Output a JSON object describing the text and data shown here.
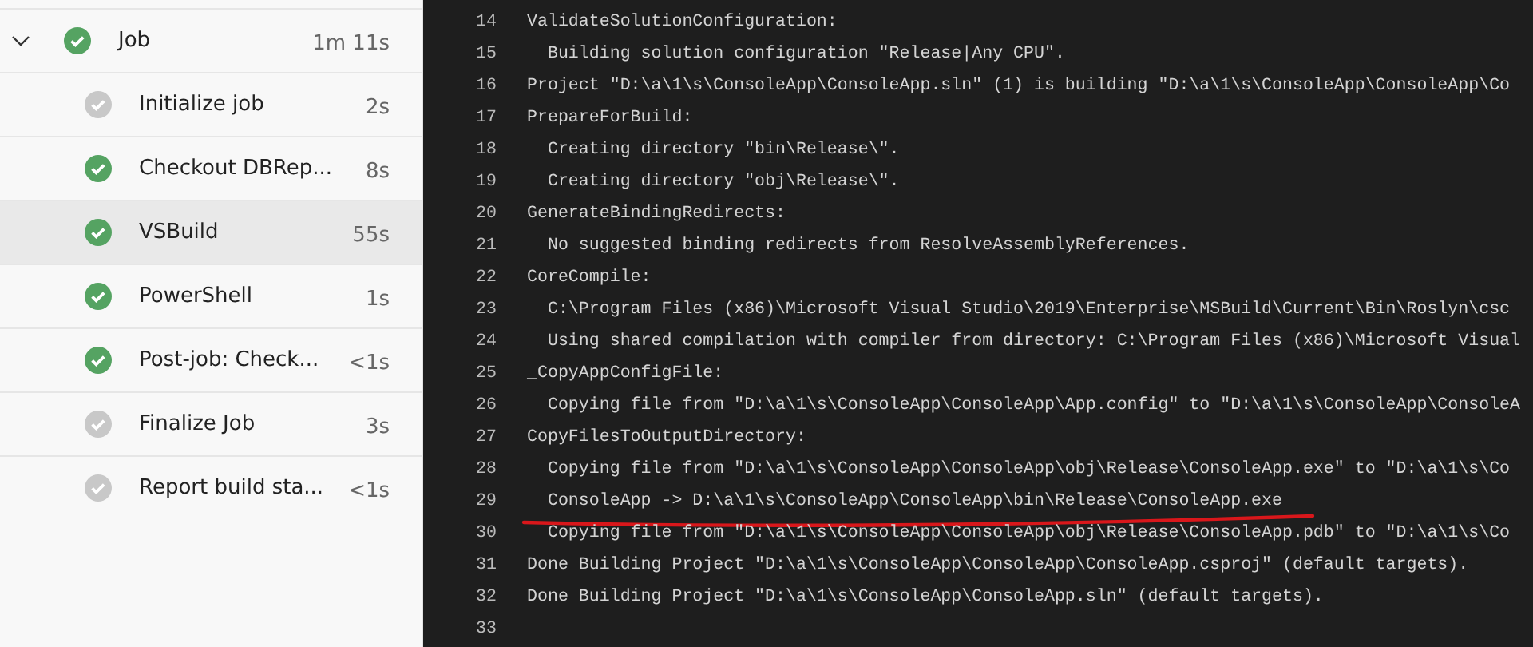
{
  "job": {
    "label": "Job",
    "duration": "1m 11s",
    "expanded": true,
    "color": "#55a362"
  },
  "steps": [
    {
      "label": "Initialize job",
      "duration": "2s",
      "color": "#c8c8c8",
      "selected": false
    },
    {
      "label": "Checkout DBRep...",
      "duration": "8s",
      "color": "#55a362",
      "selected": false
    },
    {
      "label": "VSBuild",
      "duration": "55s",
      "color": "#55a362",
      "selected": true
    },
    {
      "label": "PowerShell",
      "duration": "1s",
      "color": "#55a362",
      "selected": false
    },
    {
      "label": "Post-job: Check...",
      "duration": "<1s",
      "color": "#55a362",
      "selected": false
    },
    {
      "label": "Finalize Job",
      "duration": "3s",
      "color": "#c8c8c8",
      "selected": false
    },
    {
      "label": "Report build sta...",
      "duration": "<1s",
      "color": "#c8c8c8",
      "selected": false
    }
  ],
  "log": [
    {
      "number": "14",
      "text": "ValidateSolutionConfiguration:"
    },
    {
      "number": "15",
      "text": "  Building solution configuration \"Release|Any CPU\"."
    },
    {
      "number": "16",
      "text": "Project \"D:\\a\\1\\s\\ConsoleApp\\ConsoleApp.sln\" (1) is building \"D:\\a\\1\\s\\ConsoleApp\\ConsoleApp\\Co"
    },
    {
      "number": "17",
      "text": "PrepareForBuild:"
    },
    {
      "number": "18",
      "text": "  Creating directory \"bin\\Release\\\"."
    },
    {
      "number": "19",
      "text": "  Creating directory \"obj\\Release\\\"."
    },
    {
      "number": "20",
      "text": "GenerateBindingRedirects:"
    },
    {
      "number": "21",
      "text": "  No suggested binding redirects from ResolveAssemblyReferences."
    },
    {
      "number": "22",
      "text": "CoreCompile:"
    },
    {
      "number": "23",
      "text": "  C:\\Program Files (x86)\\Microsoft Visual Studio\\2019\\Enterprise\\MSBuild\\Current\\Bin\\Roslyn\\csc"
    },
    {
      "number": "24",
      "text": "  Using shared compilation with compiler from directory: C:\\Program Files (x86)\\Microsoft Visual"
    },
    {
      "number": "25",
      "text": "_CopyAppConfigFile:"
    },
    {
      "number": "26",
      "text": "  Copying file from \"D:\\a\\1\\s\\ConsoleApp\\ConsoleApp\\App.config\" to \"D:\\a\\1\\s\\ConsoleApp\\ConsoleA"
    },
    {
      "number": "27",
      "text": "CopyFilesToOutputDirectory:"
    },
    {
      "number": "28",
      "text": "  Copying file from \"D:\\a\\1\\s\\ConsoleApp\\ConsoleApp\\obj\\Release\\ConsoleApp.exe\" to \"D:\\a\\1\\s\\Co"
    },
    {
      "number": "29",
      "text": "  ConsoleApp -> D:\\a\\1\\s\\ConsoleApp\\ConsoleApp\\bin\\Release\\ConsoleApp.exe",
      "underlined": true
    },
    {
      "number": "30",
      "text": "  Copying file from \"D:\\a\\1\\s\\ConsoleApp\\ConsoleApp\\obj\\Release\\ConsoleApp.pdb\" to \"D:\\a\\1\\s\\Co"
    },
    {
      "number": "31",
      "text": "Done Building Project \"D:\\a\\1\\s\\ConsoleApp\\ConsoleApp\\ConsoleApp.csproj\" (default targets)."
    },
    {
      "number": "32",
      "text": "Done Building Project \"D:\\a\\1\\s\\ConsoleApp\\ConsoleApp.sln\" (default targets)."
    },
    {
      "number": "33"
    }
  ]
}
